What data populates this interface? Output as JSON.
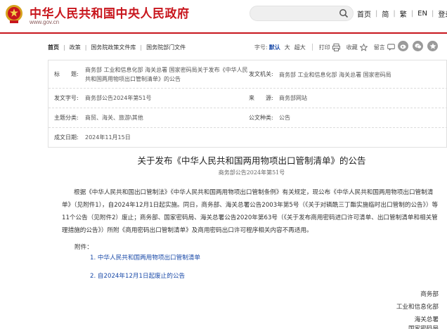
{
  "header": {
    "site_title": "中华人民共和国中央人民政府",
    "site_url": "www.gov.cn",
    "search_placeholder": "",
    "links": [
      "首页",
      "简",
      "繁",
      "EN",
      "登录"
    ]
  },
  "breadcrumb": [
    "首页",
    "政策",
    "国务院政策文件库",
    "国务院部门文件"
  ],
  "tools": {
    "font_label": "字号:",
    "font_sizes": [
      "默认",
      "大",
      "超大"
    ],
    "print": "打印",
    "favorite": "收藏",
    "comment": "留言"
  },
  "info": {
    "title_label": "标　　题:",
    "title_value": "商务部 工业和信息化部 海关总署 国家密码局关于发布《中华人民共和国两用物项出口管制清单》的公告",
    "issuer_label": "发文机关:",
    "issuer_value": "商务部 工业和信息化部 海关总署 国家密码局",
    "docno_label": "发文字号:",
    "docno_value": "商务部公告2024年第51号",
    "source_label": "来　　源:",
    "source_value": "商务部网站",
    "topic_label": "主题分类:",
    "topic_value": "商贸、海关、旅游\\其他",
    "genre_label": "公文种类:",
    "genre_value": "公告",
    "date_label": "成文日期:",
    "date_value": "2024年11月15日"
  },
  "article": {
    "title": "关于发布《中华人民共和国两用物项出口管制清单》的公告",
    "docno": "商务部公告2024年第51号",
    "body": "根据《中华人民共和国出口管制法》《中华人民共和国两用物项出口管制条例》有关规定，现公布《中华人民共和国两用物项出口管制清单》（见附件1），自2024年12月1日起实施。同日，商务部、海关总署公告2003年第5号（《关于对磷酰三丁酯实施临时出口管制的公告》）等11个公告（见附件2）废止；商务部、国家密码局、海关总署公告2020年第63号（《关于发布商用密码进口许可清单、出口管制清单和相关管理措施的公告》）所附《商用密码出口管制清单》及商用密码出口许可程序相关内容不再适用。",
    "attach_head": "附件：",
    "attachments": [
      "1. 中华人民共和国两用物项出口管制清单",
      "2. 自2024年12月1日起废止的公告"
    ],
    "signers": [
      "商务部",
      "工业和信息化部",
      "海关总署",
      "国家密码局"
    ]
  },
  "colors": {
    "brand_red": "#c8161d",
    "link_blue": "#1a4aa8"
  }
}
